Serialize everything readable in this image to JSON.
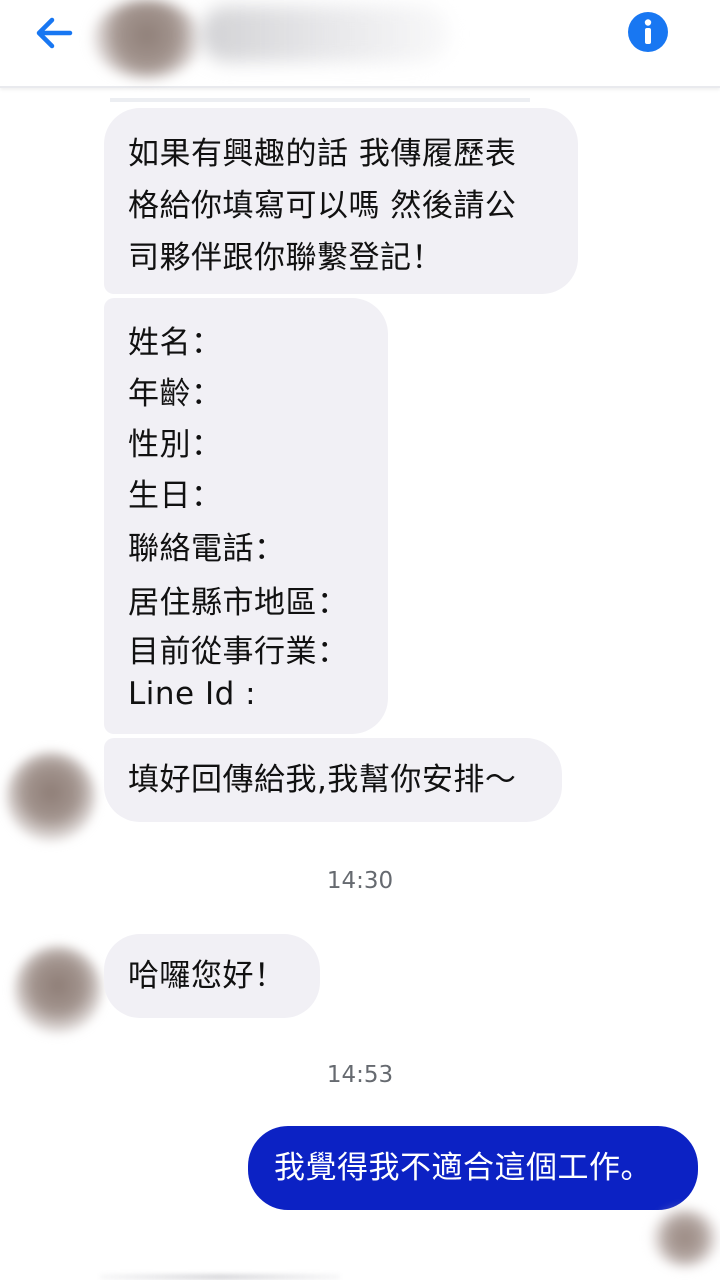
{
  "header": {
    "back_icon": "arrow-left-icon",
    "info_icon": "info-icon",
    "accent_color": "#1877f2"
  },
  "messages": {
    "m1": "如果有興趣的話 我傳履歷表\n格給你填寫可以嗎 然後請公\n司夥伴跟你聯繫登記！",
    "form_fields": [
      "姓名：",
      "年齡：",
      "性別：",
      "生日：",
      "聯絡電話：",
      "居住縣市地區：",
      "目前從事行業：",
      "Line Id :"
    ],
    "m3": "填好回傳給我,我幫你安排～",
    "timestamp1": "14:30",
    "m4": "哈囉您好！",
    "timestamp2": "14:53",
    "m5": "我覺得我不適合這個工作。"
  },
  "colors": {
    "incoming_bubble": "#f1f0f5",
    "outgoing_bubble": "#0c22c4"
  }
}
